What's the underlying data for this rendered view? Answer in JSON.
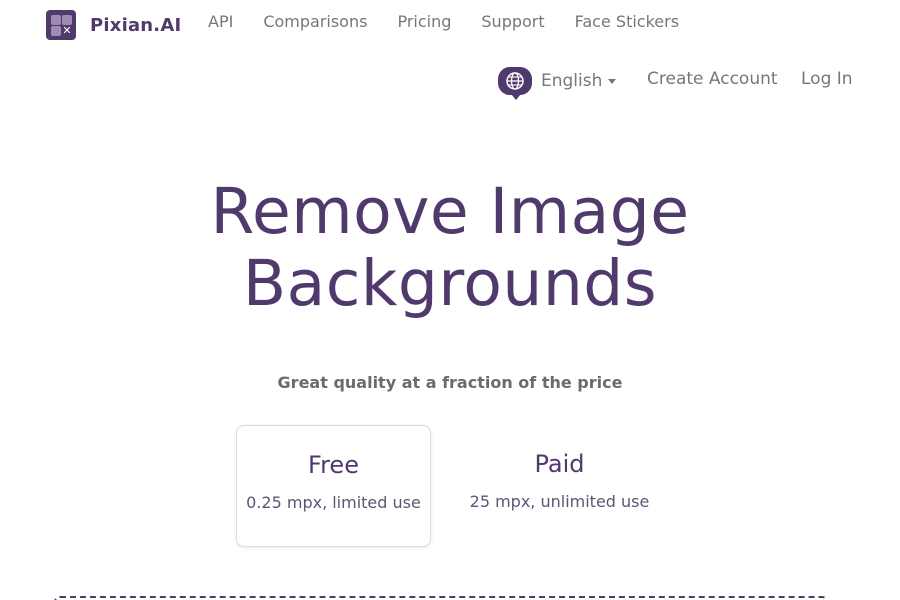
{
  "brand": {
    "name": "Pixian.AI",
    "logo_icon": "pixian-logo-icon"
  },
  "nav": {
    "items": [
      {
        "label": "API"
      },
      {
        "label": "Comparisons"
      },
      {
        "label": "Pricing"
      },
      {
        "label": "Support"
      },
      {
        "label": "Face Stickers"
      }
    ]
  },
  "subnav": {
    "language_icon": "globe-icon",
    "language": "English",
    "create_account": "Create Account",
    "log_in": "Log In"
  },
  "hero": {
    "title_line1": "Remove Image",
    "title_line2": "Backgrounds",
    "tagline": "Great quality at a fraction of the price"
  },
  "plans": [
    {
      "name": "Free",
      "description": "0.25 mpx, limited use",
      "selected": true
    },
    {
      "name": "Paid",
      "description": "25 mpx, unlimited use",
      "selected": false
    }
  ],
  "colors": {
    "brand": "#4f3a6b",
    "text": "#777777"
  }
}
